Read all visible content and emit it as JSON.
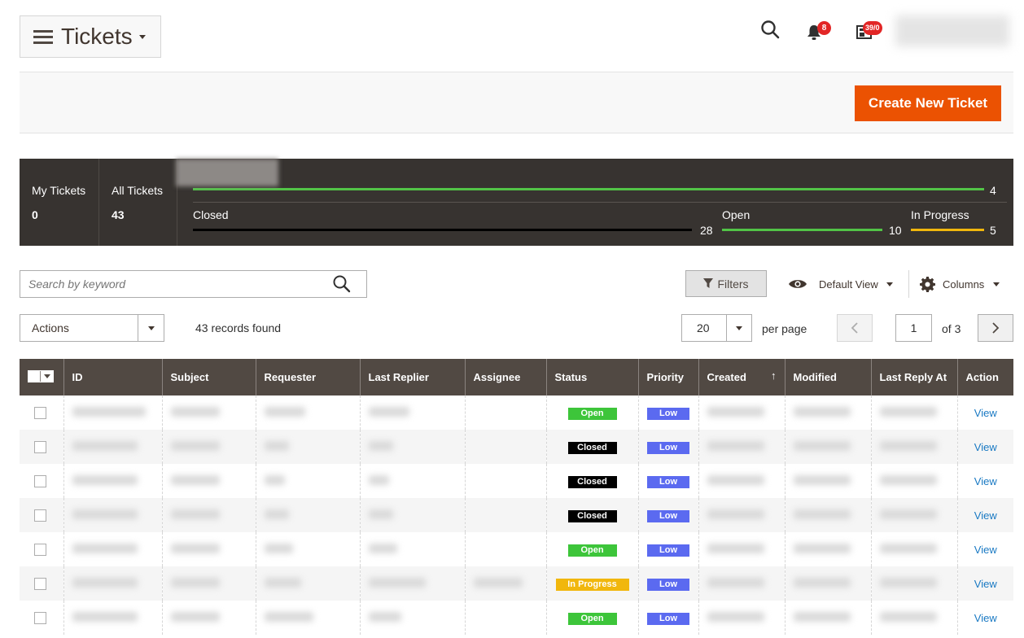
{
  "header": {
    "title": "Tickets",
    "notifications_count": "8",
    "system_messages_count": "39/0"
  },
  "action_bar": {
    "create_button": "Create New Ticket"
  },
  "stats": {
    "my_tickets_label": "My Tickets",
    "my_tickets_value": "0",
    "all_tickets_label": "All Tickets",
    "all_tickets_value": "43",
    "top_bar_value": "4",
    "closed_label": "Closed",
    "closed_value": "28",
    "open_label": "Open",
    "open_value": "10",
    "in_progress_label": "In Progress",
    "in_progress_value": "5",
    "colors": {
      "closed": "#000000",
      "open": "#52c447",
      "in_progress": "#f1b70d"
    }
  },
  "toolbar": {
    "search_placeholder": "Search by keyword",
    "filters_label": "Filters",
    "view_label": "Default View",
    "columns_label": "Columns",
    "actions_label": "Actions",
    "records_found": "43 records found",
    "per_page_value": "20",
    "per_page_label": "per page",
    "current_page": "1",
    "total_pages_label": "of 3"
  },
  "table": {
    "columns": [
      "ID",
      "Subject",
      "Requester",
      "Last Replier",
      "Assignee",
      "Status",
      "Priority",
      "Created",
      "Modified",
      "Last Reply At",
      "Action"
    ],
    "sort_indicator": "↑",
    "rows": [
      {
        "status": "Open",
        "priority": "Low",
        "action": "View"
      },
      {
        "status": "Closed",
        "priority": "Low",
        "action": "View"
      },
      {
        "status": "Closed",
        "priority": "Low",
        "action": "View"
      },
      {
        "status": "Closed",
        "priority": "Low",
        "action": "View"
      },
      {
        "status": "Open",
        "priority": "Low",
        "action": "View"
      },
      {
        "status": "In Progress",
        "priority": "Low",
        "action": "View"
      },
      {
        "status": "Open",
        "priority": "Low",
        "action": "View"
      }
    ],
    "status_colors": {
      "Open": "#3dc53a",
      "Closed": "#000000",
      "In Progress": "#f1b70d"
    },
    "priority_color": "#5b6af0"
  },
  "icons": [
    "menu-icon",
    "search-icon",
    "bell-icon",
    "system-messages-icon",
    "filter-icon",
    "eye-icon",
    "gear-icon",
    "chevron-left-icon",
    "chevron-right-icon",
    "caret-down-icon"
  ]
}
